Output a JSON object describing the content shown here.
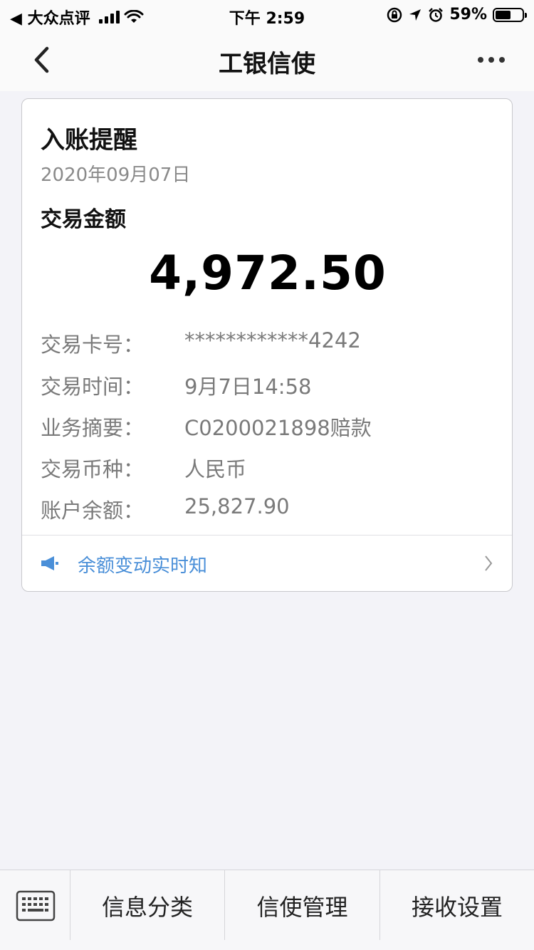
{
  "status_bar": {
    "back_app": "◀ 大众点评",
    "time": "下午 2:59",
    "battery": "59%",
    "battery_level": 0.59
  },
  "nav": {
    "title": "工银信使"
  },
  "card": {
    "title": "入账提醒",
    "date": "2020年09月07日",
    "amount_label": "交易金额",
    "amount": "4,972.50",
    "details": [
      {
        "key": "交易卡号：",
        "value": "************4242"
      },
      {
        "key": "交易时间：",
        "value": "9月7日14:58"
      },
      {
        "key": "业务摘要：",
        "value": "C0200021898赔款"
      },
      {
        "key": "交易币种：",
        "value": "人民币"
      },
      {
        "key": "账户余额：",
        "value": "25,827.90"
      }
    ],
    "footer_link": "余额变动实时知"
  },
  "bottom_bar": {
    "tabs": [
      "信息分类",
      "信使管理",
      "接收设置"
    ]
  },
  "colors": {
    "accent_link": "#4a8fd8",
    "background": "#f3f3f8"
  },
  "icons": [
    "back-chevron-icon",
    "more-dots-icon",
    "megaphone-icon",
    "chevron-right-icon",
    "keyboard-icon",
    "wifi-icon",
    "signal-icon",
    "battery-icon",
    "lock-rotation-icon",
    "location-icon",
    "alarm-icon"
  ]
}
